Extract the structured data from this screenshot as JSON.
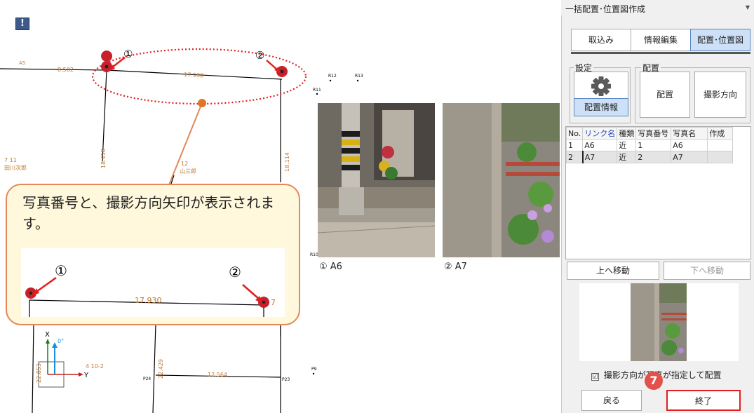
{
  "drawing": {
    "point_labels": [
      "A5",
      "R12",
      "R13",
      "R11",
      "R10",
      "P9",
      "P24",
      "P23"
    ],
    "dimensions": [
      "8.502",
      "17.930",
      "18.418",
      "18.114",
      "22.429",
      "22.853",
      "12.564"
    ],
    "owner_labels": [
      "7 11",
      "田川次郎",
      "12",
      "山三郎",
      "4 10-2"
    ],
    "marker_numbers": [
      "①",
      "②"
    ],
    "axis": {
      "x": "X",
      "y": "Y",
      "angle": "0°"
    },
    "photo_captions": [
      "① A6",
      "② A7"
    ]
  },
  "callout": {
    "text": "写真番号と、撮影方向矢印が表示されます。",
    "inset_dimension": "17.930",
    "inset_label": "7"
  },
  "panel": {
    "title": "一括配置･位置図作成",
    "tabs": [
      "取込み",
      "情報編集",
      "配置･位置図"
    ],
    "settings_group": "設定",
    "settings_button": "配置情報",
    "placement_group": "配置",
    "place_button": "配置",
    "direction_button": "撮影方向",
    "table": {
      "headers": [
        "No.",
        "リンク名",
        "種類",
        "写真番号",
        "写真名",
        "作成"
      ],
      "rows": [
        [
          "1",
          "A6",
          "近",
          "1",
          "A6",
          ""
        ],
        [
          "2",
          "A7",
          "近",
          "2",
          "A7",
          ""
        ]
      ]
    },
    "move_up": "上へ移動",
    "move_down": "下へ移動",
    "checkbox_label": "撮影方向が写真が指定して配置",
    "checkbox_mark": "☑",
    "back_button": "戻る",
    "finish_button": "終了",
    "step_number": "7"
  },
  "colors": {
    "accent_red": "#e02020",
    "callout_border": "#e2885a",
    "callout_fill": "#fff8dc",
    "marker": "#c8202a",
    "dim_text": "#c07830"
  }
}
